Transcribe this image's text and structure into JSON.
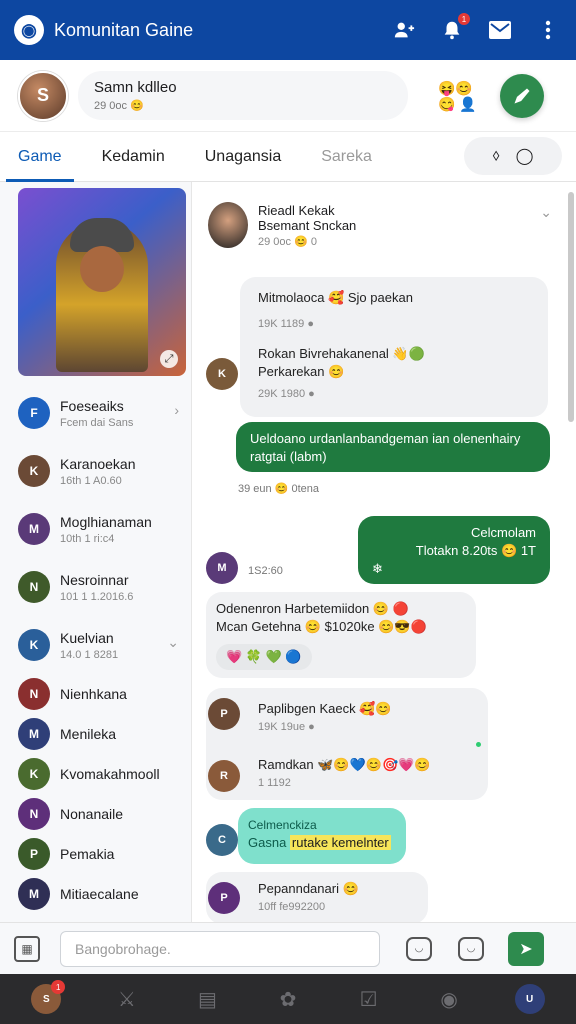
{
  "app": {
    "title": "Komunitan Gaine"
  },
  "appbar": {
    "icons": [
      "person-add-icon",
      "notifications-icon",
      "mail-icon",
      "more-vert-icon"
    ],
    "badge_count": "1"
  },
  "profile": {
    "name": "Samn kdlleo",
    "sub": "29 0oc 😊",
    "emojis": "😝😊😋 👤",
    "avatar_initials": "S"
  },
  "tabs": [
    {
      "label": "Game"
    },
    {
      "label": "Kedamin"
    },
    {
      "label": "Unagansia"
    },
    {
      "label": "Sareka"
    }
  ],
  "tab_pill": {
    "left": "⬨",
    "right": "◯"
  },
  "contacts": [
    {
      "name": "Foeseaiks",
      "meta": "Fcem dai Sans",
      "initials": "F",
      "color": "#1e62c0"
    },
    {
      "name": "Karanoekan",
      "meta": "16th 1 A0.60",
      "initials": "K",
      "color": "#6b4a36"
    },
    {
      "name": "Moglhianaman",
      "meta": "10th 1 ri:c4",
      "initials": "M",
      "color": "#5a3a78"
    },
    {
      "name": "Nesroinnar",
      "meta": "101 1 1.2016.6",
      "initials": "N",
      "color": "#3f5a2a"
    },
    {
      "name": "Kuelvian",
      "meta": "14.0 1 8281",
      "initials": "K",
      "color": "#2a5f9a"
    },
    {
      "name": "Nienhkana",
      "meta": "",
      "initials": "N",
      "color": "#8a2f2f"
    },
    {
      "name": "Menileka",
      "meta": "",
      "initials": "M",
      "color": "#2f3f78"
    },
    {
      "name": "Kvomakahmooll",
      "meta": "",
      "initials": "K",
      "color": "#4a6b2f"
    },
    {
      "name": "Nonanaile",
      "meta": "",
      "initials": "N",
      "color": "#5e2f7a"
    },
    {
      "name": "Pemakia",
      "meta": "",
      "initials": "P",
      "color": "#3a5a2a"
    },
    {
      "name": "Mitiaecalane",
      "meta": "",
      "initials": "M",
      "color": "#2f2f55"
    }
  ],
  "chat_header": {
    "line1": "Rieadl Kekak",
    "line2": "Bsemant Snckan",
    "line3": "29 0oc 😊 0"
  },
  "messages": {
    "m1": {
      "text": "Mitmolaoca 🥰 Sjo paekan",
      "meta": "19K 1189 ●"
    },
    "m2": {
      "text1": "Rokan Bivrehakanenal 👋🟢",
      "text2": "Perkarekan 😊",
      "meta": "29K 1980 ●"
    },
    "m3": {
      "text": "Ueldoano urdanlanbandgeman ian olenenhairy ratgtai (labm)"
    },
    "m3_meta": "39 eun 😊 0tena",
    "m4": {
      "line1": "Celcmolam",
      "line2": "Tlotakn 8.20ts 😊 1T",
      "line3": "❄"
    },
    "m4_meta": "1S2:60",
    "m5": {
      "line1": "Odenenron Harbetemiidon 😊 🔴",
      "line2": "Mcan Getehna 😊 $1020ke 😊😎🔴",
      "reactions": "💗 🍀 💚 🔵"
    },
    "m6": {
      "line1": "Paplibgen Kaeck 🥰😊",
      "line2": "19K 19ue ●"
    },
    "m7": {
      "line1": "Ramdkan 🦋😊💙😊🎯💗😊",
      "line2": "1 1192"
    },
    "m8": {
      "line1": "Celmenckiza",
      "pre": "Gasna ",
      "highlight": "rutake kemelnter"
    },
    "m9": {
      "line1": "Pepanndanari 😊",
      "line2": "10ff fe992200"
    }
  },
  "composer": {
    "placeholder": "Bangobrohage."
  },
  "bottomnav": {
    "items": [
      "profile-avatar",
      "fight-icon",
      "book-icon",
      "gear-icon",
      "edit-icon",
      "location-icon",
      "user-avatar"
    ],
    "badge": "1"
  },
  "colors": {
    "brand": "#0d47a1",
    "accent": "#2e8b4e",
    "tab_active": "#0d5bb5"
  }
}
